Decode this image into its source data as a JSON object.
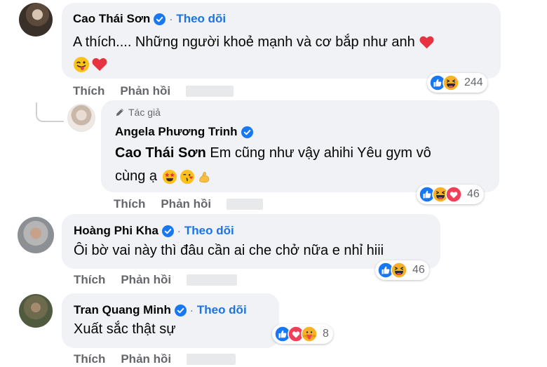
{
  "comments": [
    {
      "name": "Cao Thái Sơn",
      "dot": "·",
      "follow": "Theo dõi",
      "text": "A thích.... Những người khoẻ mạnh và cơ bắp như anh",
      "reaction_count": "244",
      "actions": {
        "like": "Thích",
        "reply": "Phản hồi"
      }
    },
    {
      "author_badge": "Tác giả",
      "name": "Angela Phương Trinh",
      "mention": "Cao Thái Sơn",
      "text_line1": "Em cũng như vậy ahihi Yêu gym vô",
      "text_line2": "cùng ạ",
      "reaction_count": "46",
      "actions": {
        "like": "Thích",
        "reply": "Phản hồi"
      }
    },
    {
      "name": "Hoàng Phi Kha",
      "dot": "·",
      "follow": "Theo dõi",
      "text": "Ôi bờ vai này thì đâu cần ai che chở nữa e nhỉ hiii",
      "reaction_count": "46",
      "actions": {
        "like": "Thích",
        "reply": "Phản hồi"
      }
    },
    {
      "name": "Tran Quang Minh",
      "dot": "·",
      "follow": "Theo dõi",
      "text": "Xuất sắc thật sự",
      "reaction_count": "8",
      "actions": {
        "like": "Thích",
        "reply": "Phản hồi"
      }
    }
  ],
  "colors": {
    "link": "#1b74e4",
    "bubble": "#f0f2f5",
    "muted": "#65676b",
    "like": "#1877f2",
    "love": "#f33e58",
    "haha": "#f7b125"
  },
  "icons": [
    "verified-badge-icon",
    "like-reaction-icon",
    "haha-reaction-icon",
    "love-reaction-icon",
    "care-reaction-icon",
    "pencil-icon",
    "winking-tongue-emoji",
    "red-heart-emoji",
    "star-struck-emoji",
    "kissing-heart-emoji",
    "flexed-biceps-emoji"
  ]
}
